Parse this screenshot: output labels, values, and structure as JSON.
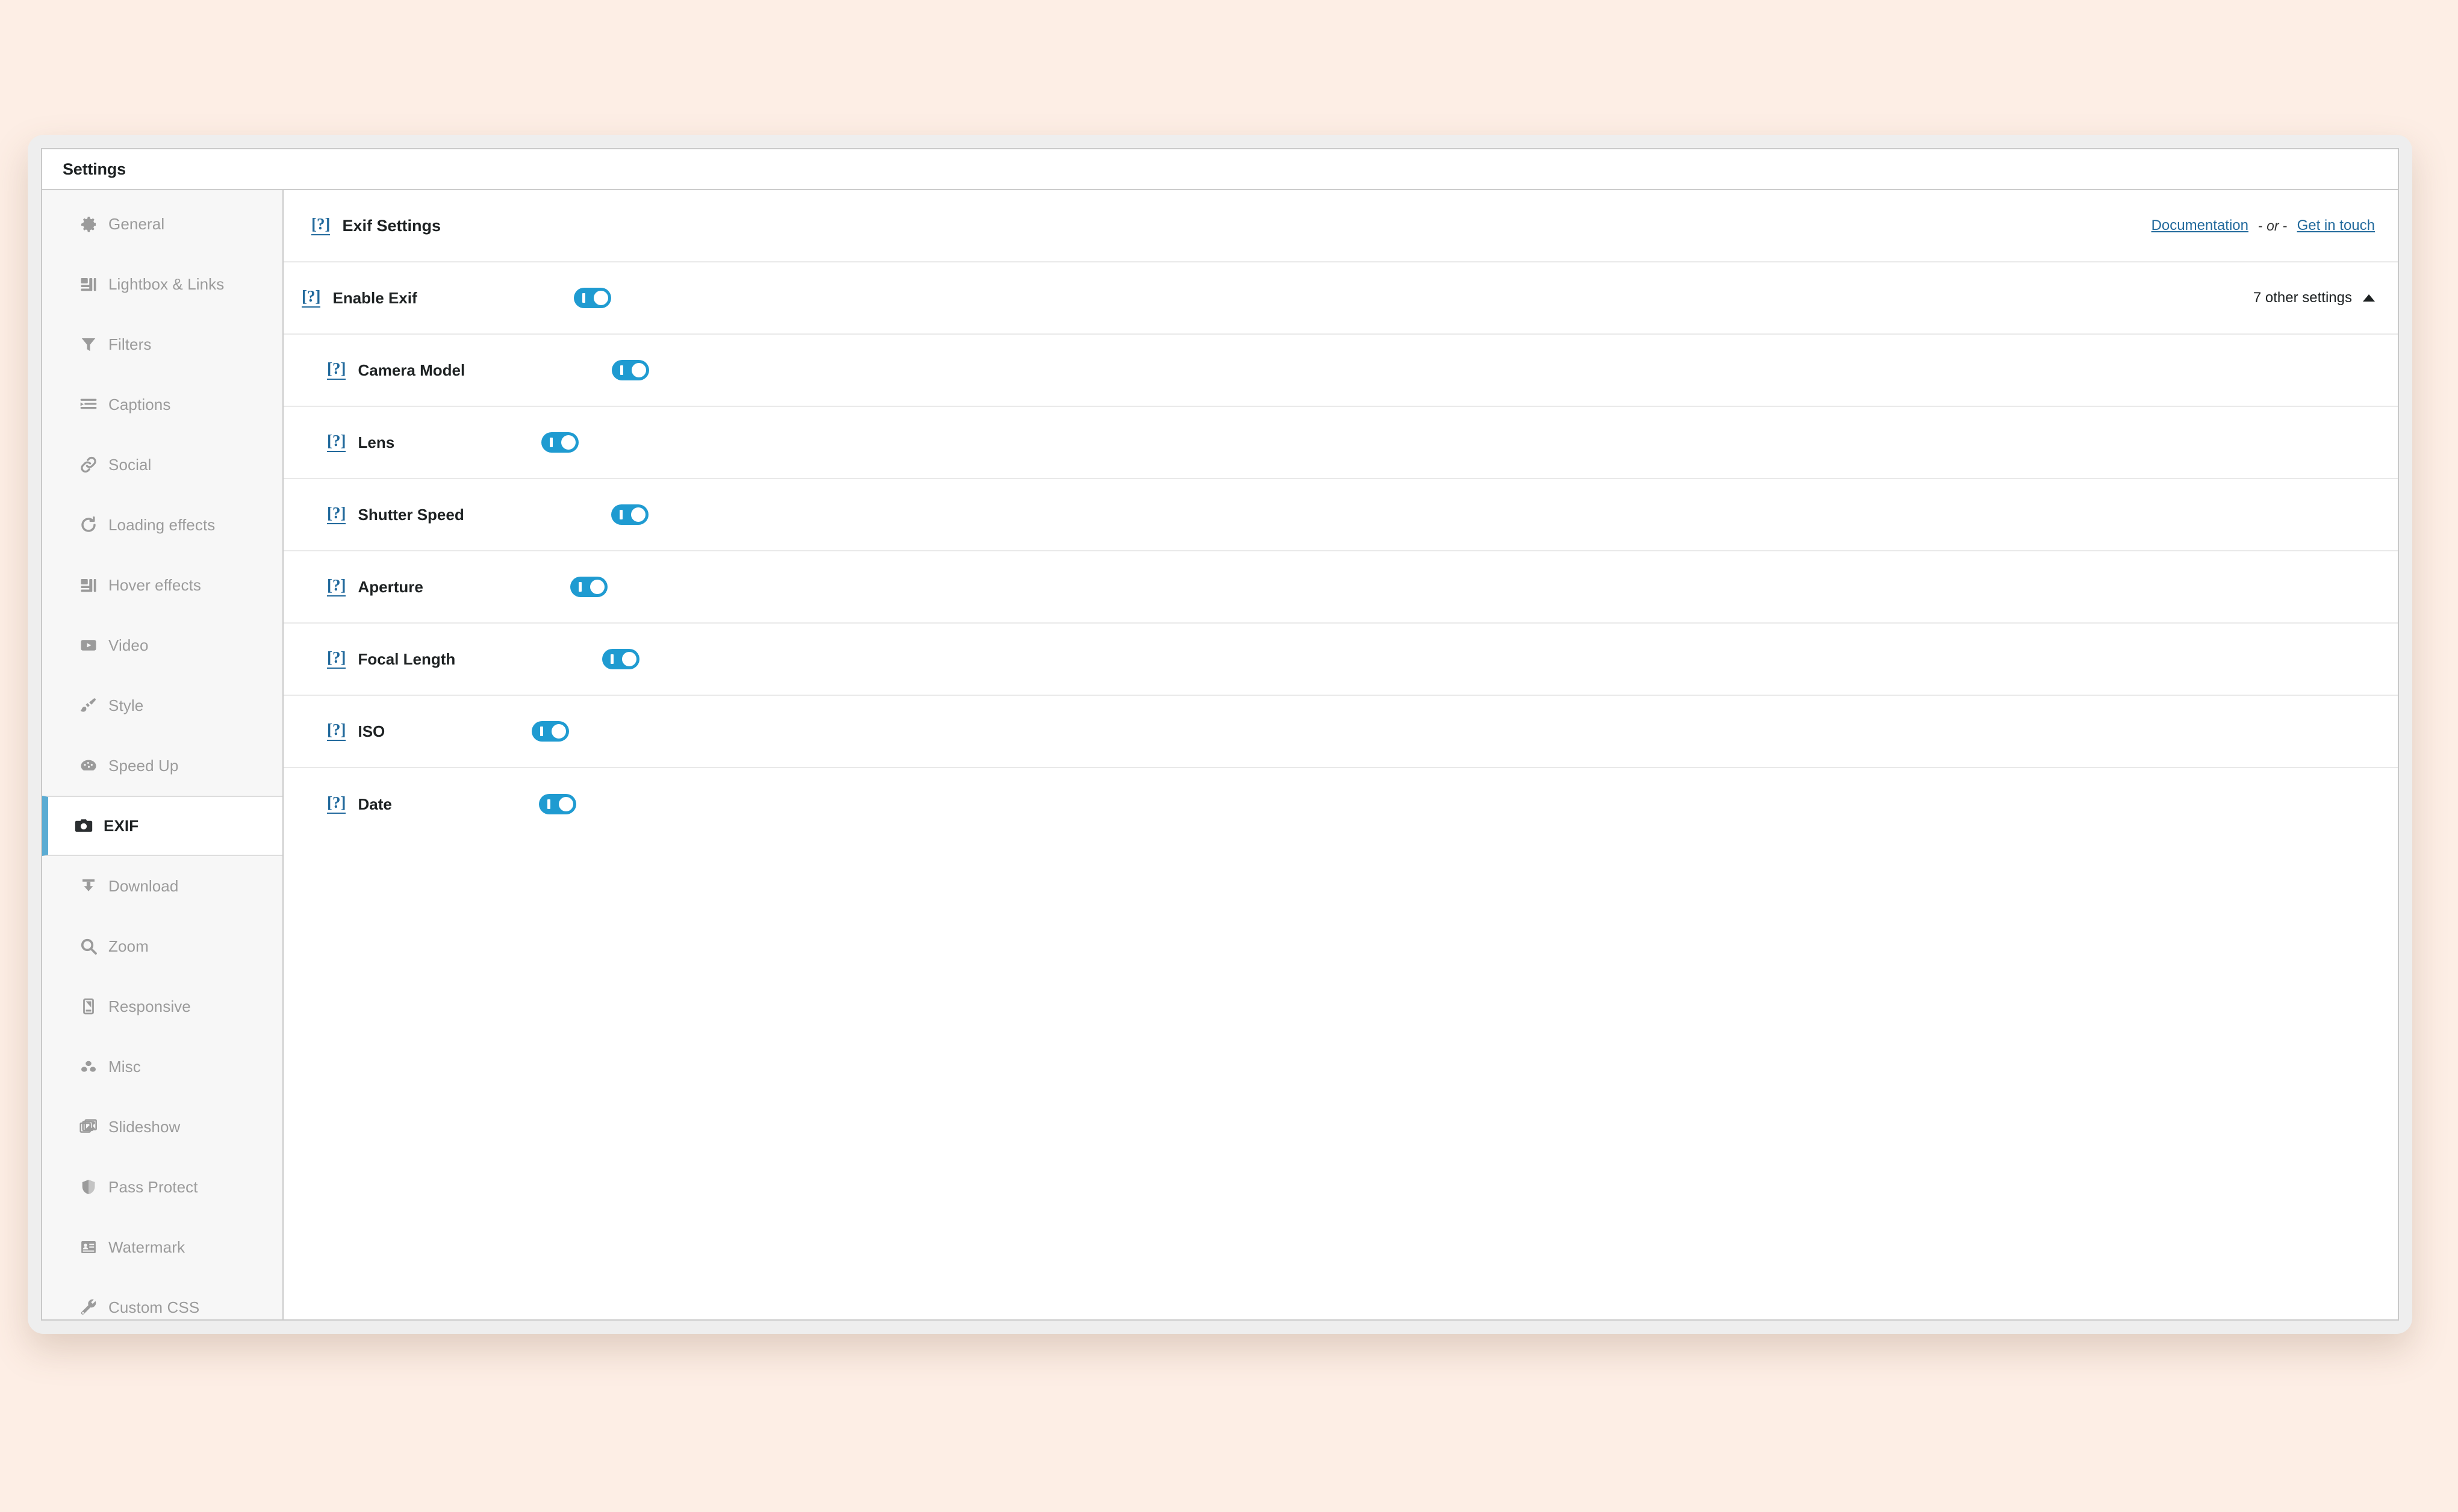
{
  "window": {
    "title": "Settings"
  },
  "sidebar": {
    "items": [
      {
        "label": "General",
        "icon": "gear-icon",
        "active": false
      },
      {
        "label": "Lightbox & Links",
        "icon": "layout-icon",
        "active": false
      },
      {
        "label": "Filters",
        "icon": "funnel-icon",
        "active": false
      },
      {
        "label": "Captions",
        "icon": "text-lines-icon",
        "active": false
      },
      {
        "label": "Social",
        "icon": "link-icon",
        "active": false
      },
      {
        "label": "Loading effects",
        "icon": "rotate-ccw-icon",
        "active": false
      },
      {
        "label": "Hover effects",
        "icon": "layout-icon",
        "active": false
      },
      {
        "label": "Video",
        "icon": "play-box-icon",
        "active": false
      },
      {
        "label": "Style",
        "icon": "paint-brush-icon",
        "active": false
      },
      {
        "label": "Speed Up",
        "icon": "gauge-icon",
        "active": false
      },
      {
        "label": "EXIF",
        "icon": "camera-icon",
        "active": true
      },
      {
        "label": "Download",
        "icon": "download-icon",
        "active": false
      },
      {
        "label": "Zoom",
        "icon": "search-icon",
        "active": false
      },
      {
        "label": "Responsive",
        "icon": "mobile-icon",
        "active": false
      },
      {
        "label": "Misc",
        "icon": "dots-cluster-icon",
        "active": false
      },
      {
        "label": "Slideshow",
        "icon": "images-stack-icon",
        "active": false
      },
      {
        "label": "Pass Protect",
        "icon": "shield-icon",
        "active": false
      },
      {
        "label": "Watermark",
        "icon": "id-card-icon",
        "active": false
      },
      {
        "label": "Custom CSS",
        "icon": "wrench-icon",
        "active": false
      }
    ]
  },
  "main": {
    "section_title": "Exif Settings",
    "help_glyph": "[?]",
    "links": {
      "documentation": "Documentation",
      "separator_prefix": "-",
      "separator_word": "or",
      "separator_suffix": "-",
      "get_in_touch": "Get in touch"
    },
    "parent_setting": {
      "label": "Enable Exif",
      "toggle_on": true,
      "other_settings_label": "7 other settings",
      "expanded": true
    },
    "sub_settings": [
      {
        "label": "Camera Model",
        "toggle_on": true
      },
      {
        "label": "Lens",
        "toggle_on": true
      },
      {
        "label": "Shutter Speed",
        "toggle_on": true
      },
      {
        "label": "Aperture",
        "toggle_on": true
      },
      {
        "label": "Focal Length",
        "toggle_on": true
      },
      {
        "label": "ISO",
        "toggle_on": true
      },
      {
        "label": "Date",
        "toggle_on": true
      }
    ]
  },
  "colors": {
    "accent_blue": "#1f9bd1",
    "active_border": "#5bacd3",
    "link_blue": "#21699c",
    "page_background": "#fdeee5",
    "sidebar_background": "#f7f7f7"
  }
}
